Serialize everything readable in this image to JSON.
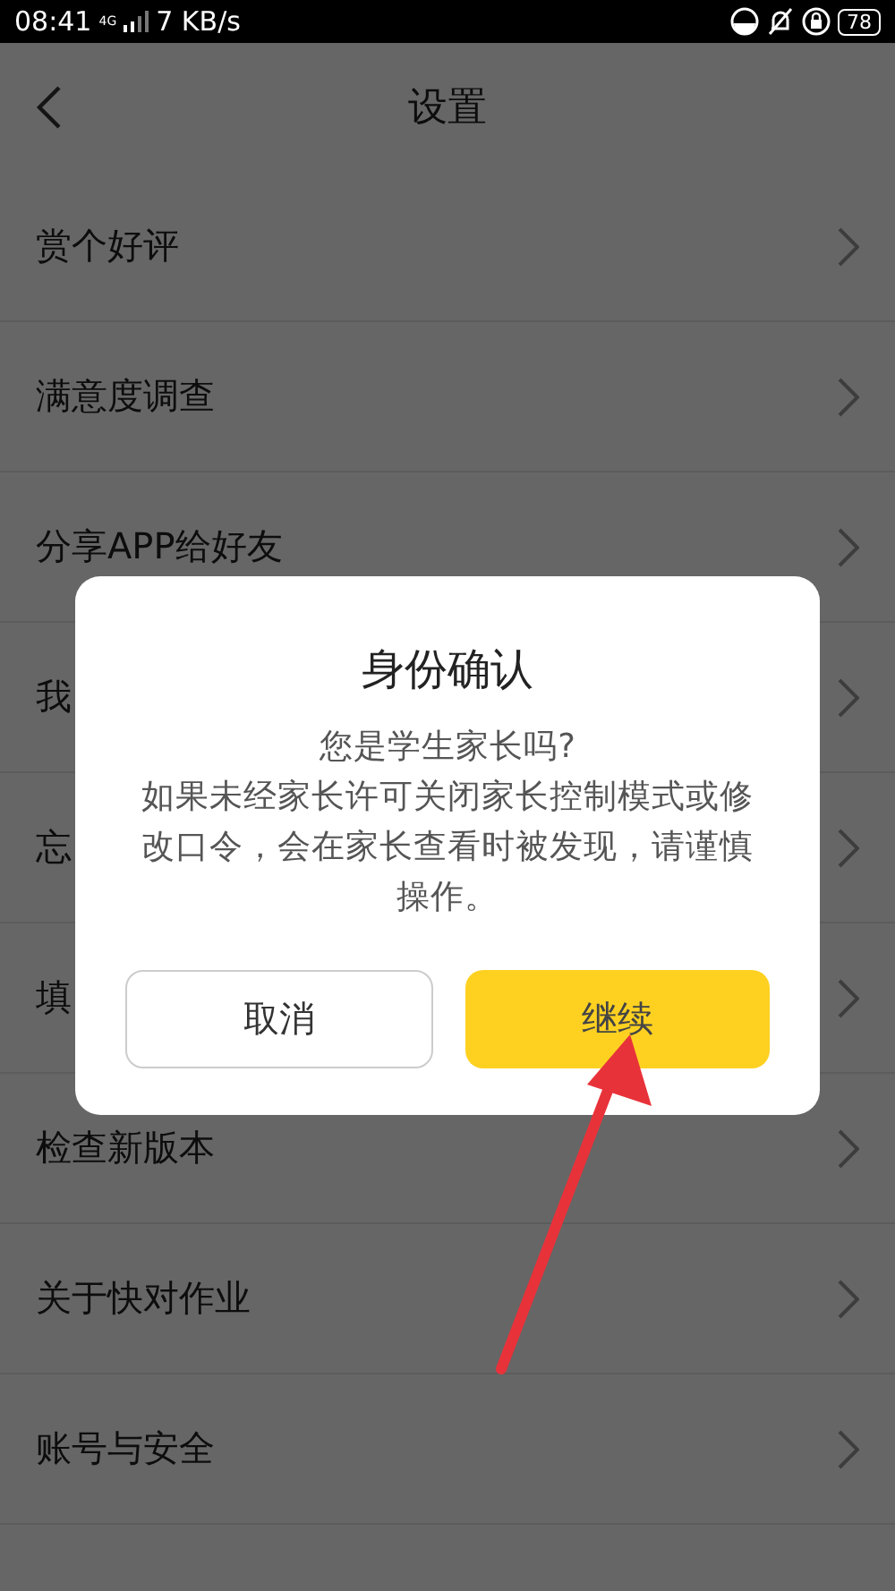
{
  "status_bar": {
    "time": "08:41",
    "network": "4G",
    "speed": "7 KB/s",
    "battery": "78"
  },
  "header": {
    "title": "设置"
  },
  "settings": [
    {
      "label": "赏个好评"
    },
    {
      "label": "满意度调查"
    },
    {
      "label": "分享APP给好友"
    },
    {
      "label": "我"
    },
    {
      "label": "忘"
    },
    {
      "label": "填"
    },
    {
      "label": "检查新版本"
    },
    {
      "label": "关于快对作业"
    },
    {
      "label": "账号与安全"
    }
  ],
  "dialog": {
    "title": "身份确认",
    "message": "您是学生家长吗?\n如果未经家长许可关闭家长控制模式或修改口令，会在家长查看时被发现，请谨慎操作。",
    "buttons": [
      {
        "label": "取消",
        "kind": "secondary"
      },
      {
        "label": "继续",
        "kind": "primary"
      }
    ]
  }
}
